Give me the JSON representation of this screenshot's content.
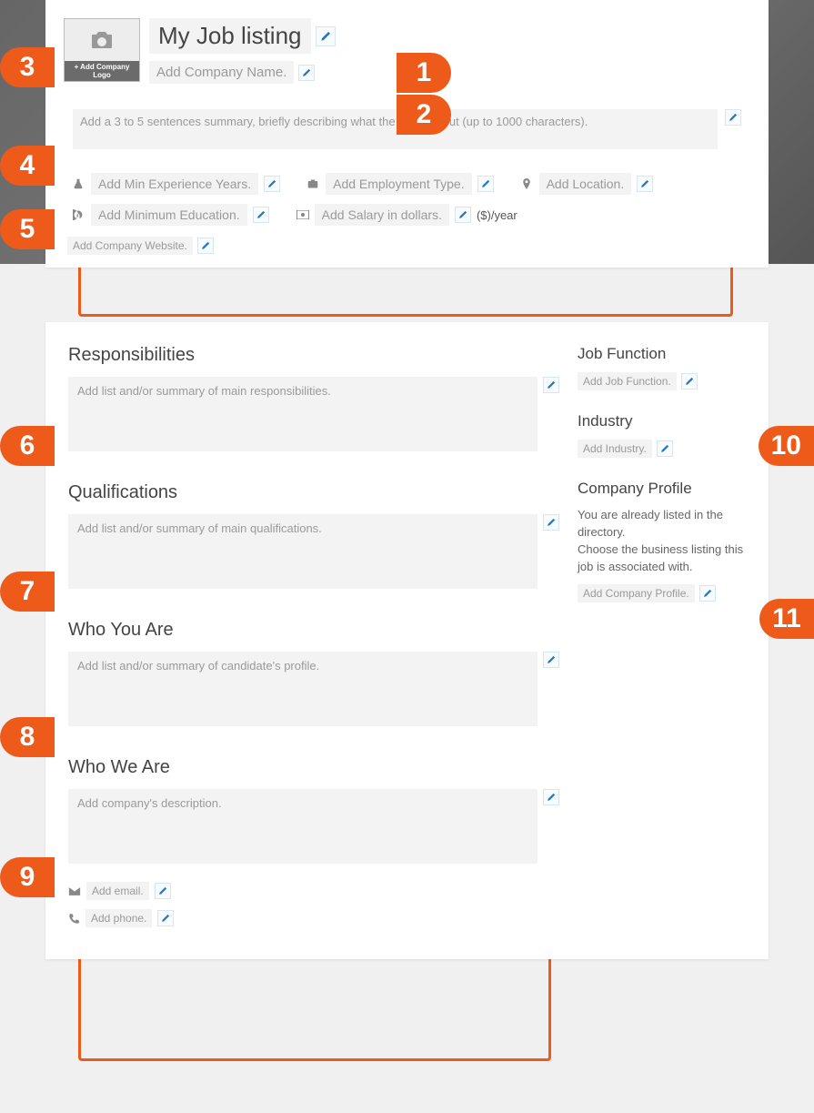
{
  "callouts": [
    "1",
    "2",
    "3",
    "4",
    "5",
    "6",
    "7",
    "8",
    "9",
    "10",
    "11"
  ],
  "header": {
    "title": "My Job listing",
    "add_logo": "+ Add Company Logo",
    "company_name_placeholder": "Add Company Name."
  },
  "summary": {
    "placeholder": "Add a 3 to 5 sentences summary, briefly describing what the job is about (up to 1000 characters)."
  },
  "meta": {
    "experience_placeholder": "Add Min Experience Years.",
    "employment_type_placeholder": "Add Employment Type.",
    "location_placeholder": "Add Location.",
    "education_placeholder": "Add Minimum Education.",
    "salary_placeholder": "Add Salary in dollars.",
    "salary_suffix": "($)/year",
    "website_placeholder": "Add Company Website."
  },
  "sections": {
    "responsibilities": {
      "heading": "Responsibilities",
      "placeholder": "Add list and/or summary of main responsibilities."
    },
    "qualifications": {
      "heading": "Qualifications",
      "placeholder": "Add list and/or summary of main qualifications."
    },
    "who_you_are": {
      "heading": "Who You Are",
      "placeholder": "Add list and/or summary of candidate's profile."
    },
    "who_we_are": {
      "heading": "Who We Are",
      "placeholder": "Add company's description."
    }
  },
  "contact": {
    "email_placeholder": "Add email.",
    "phone_placeholder": "Add phone."
  },
  "sidebar": {
    "job_function": {
      "heading": "Job Function",
      "placeholder": "Add Job Function."
    },
    "industry": {
      "heading": "Industry",
      "placeholder": "Add Industry."
    },
    "company_profile": {
      "heading": "Company Profile",
      "desc": "You are already listed in the directory.\nChoose the business listing this job is associated with.",
      "placeholder": "Add Company Profile."
    }
  }
}
